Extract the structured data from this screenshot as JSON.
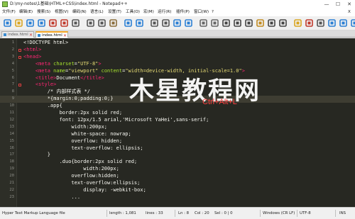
{
  "window": {
    "title": "D:\\my-notes\\1基础\\HTML+CSS\\index.html - Notepad++",
    "controls": [
      "—",
      "☐",
      "✕"
    ]
  },
  "menu": [
    "文件(F)",
    "编辑(E)",
    "搜索(S)",
    "视图(V)",
    "编码(N)",
    "语言(L)",
    "设置(T)",
    "工具(O)",
    "宏(M)",
    "运行(R)",
    "插件(P)",
    "窗口(W)",
    "?"
  ],
  "menu_close": "X",
  "tabs": [
    {
      "label": "index.html",
      "active": false
    },
    {
      "label": "index.html",
      "active": true
    }
  ],
  "editor": {
    "lines": [
      {
        "n": "1",
        "segs": [
          [
            "t",
            "<!DOCTYPE html>"
          ]
        ]
      },
      {
        "n": "2",
        "segs": [
          [
            "g",
            "<html>"
          ]
        ]
      },
      {
        "n": "3",
        "segs": [
          [
            "g",
            "<head>"
          ]
        ]
      },
      {
        "n": "4",
        "segs": [
          [
            "x",
            "    "
          ],
          [
            "g",
            "<meta "
          ],
          [
            "a",
            "charset"
          ],
          [
            "x",
            "="
          ],
          [
            "s",
            "\"UTF-8\""
          ],
          [
            "g",
            ">"
          ]
        ]
      },
      {
        "n": "5",
        "segs": [
          [
            "x",
            "    "
          ],
          [
            "g",
            "<meta "
          ],
          [
            "a",
            "name"
          ],
          [
            "x",
            "="
          ],
          [
            "s",
            "\"viewport\""
          ],
          [
            "x",
            " "
          ],
          [
            "a",
            "content"
          ],
          [
            "x",
            "="
          ],
          [
            "s",
            "\"width=device-width, initial-scale=1.0\""
          ],
          [
            "g",
            ">"
          ]
        ]
      },
      {
        "n": "6",
        "segs": [
          [
            "x",
            "    "
          ],
          [
            "g",
            "<title>"
          ],
          [
            "t",
            "Document"
          ],
          [
            "g",
            "</title>"
          ]
        ]
      },
      {
        "n": "7",
        "segs": [
          [
            "x",
            "    "
          ],
          [
            "g",
            "<style>"
          ]
        ]
      },
      {
        "n": "8",
        "segs": [
          [
            "c",
            "        /* 内部样式表 */"
          ]
        ]
      },
      {
        "n": "9",
        "segs": [
          [
            "t",
            "        *{margin:0;padding:0;}"
          ]
        ]
      },
      {
        "n": "10",
        "segs": [
          [
            "t",
            "        .app{"
          ]
        ]
      },
      {
        "n": "11",
        "segs": [
          [
            "t",
            "            border:2px solid red;"
          ]
        ]
      },
      {
        "n": "12",
        "segs": [
          [
            "t",
            "            font: 12px/1.5 arial,'Microsoft YaHei',sans-serif;"
          ]
        ]
      },
      {
        "n": "13",
        "segs": [
          [
            "t",
            "                width:200px;"
          ]
        ]
      },
      {
        "n": "14",
        "segs": [
          [
            "t",
            "                white-space: nowrap;"
          ]
        ]
      },
      {
        "n": "15",
        "segs": [
          [
            "t",
            "                overflow: hidden;"
          ]
        ]
      },
      {
        "n": "16",
        "segs": [
          [
            "t",
            "                text-overflow: ellipsis;"
          ]
        ]
      },
      {
        "n": "17",
        "segs": [
          [
            "t",
            "        }"
          ]
        ]
      },
      {
        "n": "18",
        "segs": [
          [
            "t",
            "            .duo{border:2px solid red;"
          ]
        ]
      },
      {
        "n": "19",
        "segs": [
          [
            "t",
            "                    width:200px;"
          ]
        ]
      },
      {
        "n": "20",
        "segs": [
          [
            "t",
            "                overflow:hidden;"
          ]
        ]
      },
      {
        "n": "21",
        "segs": [
          [
            "t",
            "                text-overflow:ellipsis;"
          ]
        ]
      },
      {
        "n": "22",
        "segs": [
          [
            "t",
            "                    display: -webkit-box;"
          ]
        ]
      },
      {
        "n": "23",
        "segs": [
          [
            "t",
            "                ..."
          ]
        ]
      }
    ],
    "current_line": "9",
    "fold_marks": [
      "2",
      "3",
      "7"
    ]
  },
  "watermark": "木星教程网",
  "overlay_shortcut": "Ctrl+Alt+L",
  "status": {
    "language": "Hyper Text Markup Language file",
    "length": "length : 1,081",
    "lines": "lines : 33",
    "ln": "Ln : 8",
    "col": "Col : 20",
    "sel": "Sel : 0 | 0",
    "eol": "Windows (CR LF)",
    "encoding": "UTF-8",
    "mode": "INS"
  },
  "colors": {
    "editor_bg": "#272822",
    "tag": "#f92672",
    "attr": "#a6e22e",
    "string": "#e6db74",
    "text": "#f8f8f2",
    "watermark": "#ffffff",
    "shortcut": "#ff4040"
  },
  "toolbar_icons": [
    "new-file-icon",
    "open-file-icon",
    "save-icon",
    "save-all-icon",
    "close-icon",
    "close-all-icon",
    "print-icon",
    "cut-icon",
    "copy-icon",
    "paste-icon",
    "undo-icon",
    "redo-icon",
    "find-icon",
    "replace-icon",
    "zoom-in-icon",
    "zoom-out-icon",
    "sync-v-icon",
    "sync-h-icon",
    "word-wrap-icon",
    "show-all-chars-icon",
    "indent-guide-icon",
    "udl-icon",
    "doc-map-icon",
    "function-list-icon",
    "folder-workspace-icon",
    "record-macro-icon",
    "stop-macro-icon",
    "play-macro-icon",
    "run-macro-icon",
    "save-macro-icon"
  ]
}
